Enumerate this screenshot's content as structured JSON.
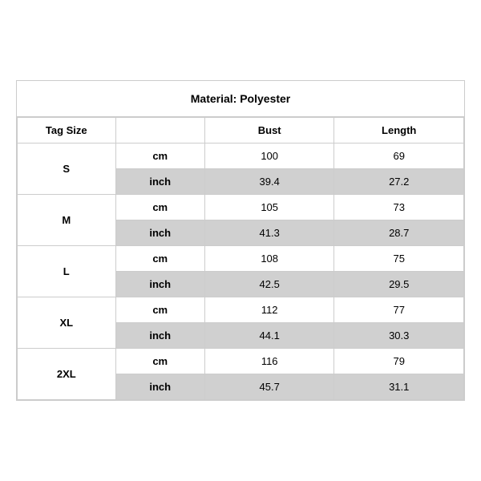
{
  "title": "Material: Polyester",
  "headers": {
    "tag_size": "Tag Size",
    "bust": "Bust",
    "length": "Length"
  },
  "rows": [
    {
      "size": "S",
      "cm": {
        "bust": "100",
        "length": "69"
      },
      "inch": {
        "bust": "39.4",
        "length": "27.2"
      }
    },
    {
      "size": "M",
      "cm": {
        "bust": "105",
        "length": "73"
      },
      "inch": {
        "bust": "41.3",
        "length": "28.7"
      }
    },
    {
      "size": "L",
      "cm": {
        "bust": "108",
        "length": "75"
      },
      "inch": {
        "bust": "42.5",
        "length": "29.5"
      }
    },
    {
      "size": "XL",
      "cm": {
        "bust": "112",
        "length": "77"
      },
      "inch": {
        "bust": "44.1",
        "length": "30.3"
      }
    },
    {
      "size": "2XL",
      "cm": {
        "bust": "116",
        "length": "79"
      },
      "inch": {
        "bust": "45.7",
        "length": "31.1"
      }
    }
  ],
  "unit_labels": {
    "cm": "cm",
    "inch": "inch"
  }
}
